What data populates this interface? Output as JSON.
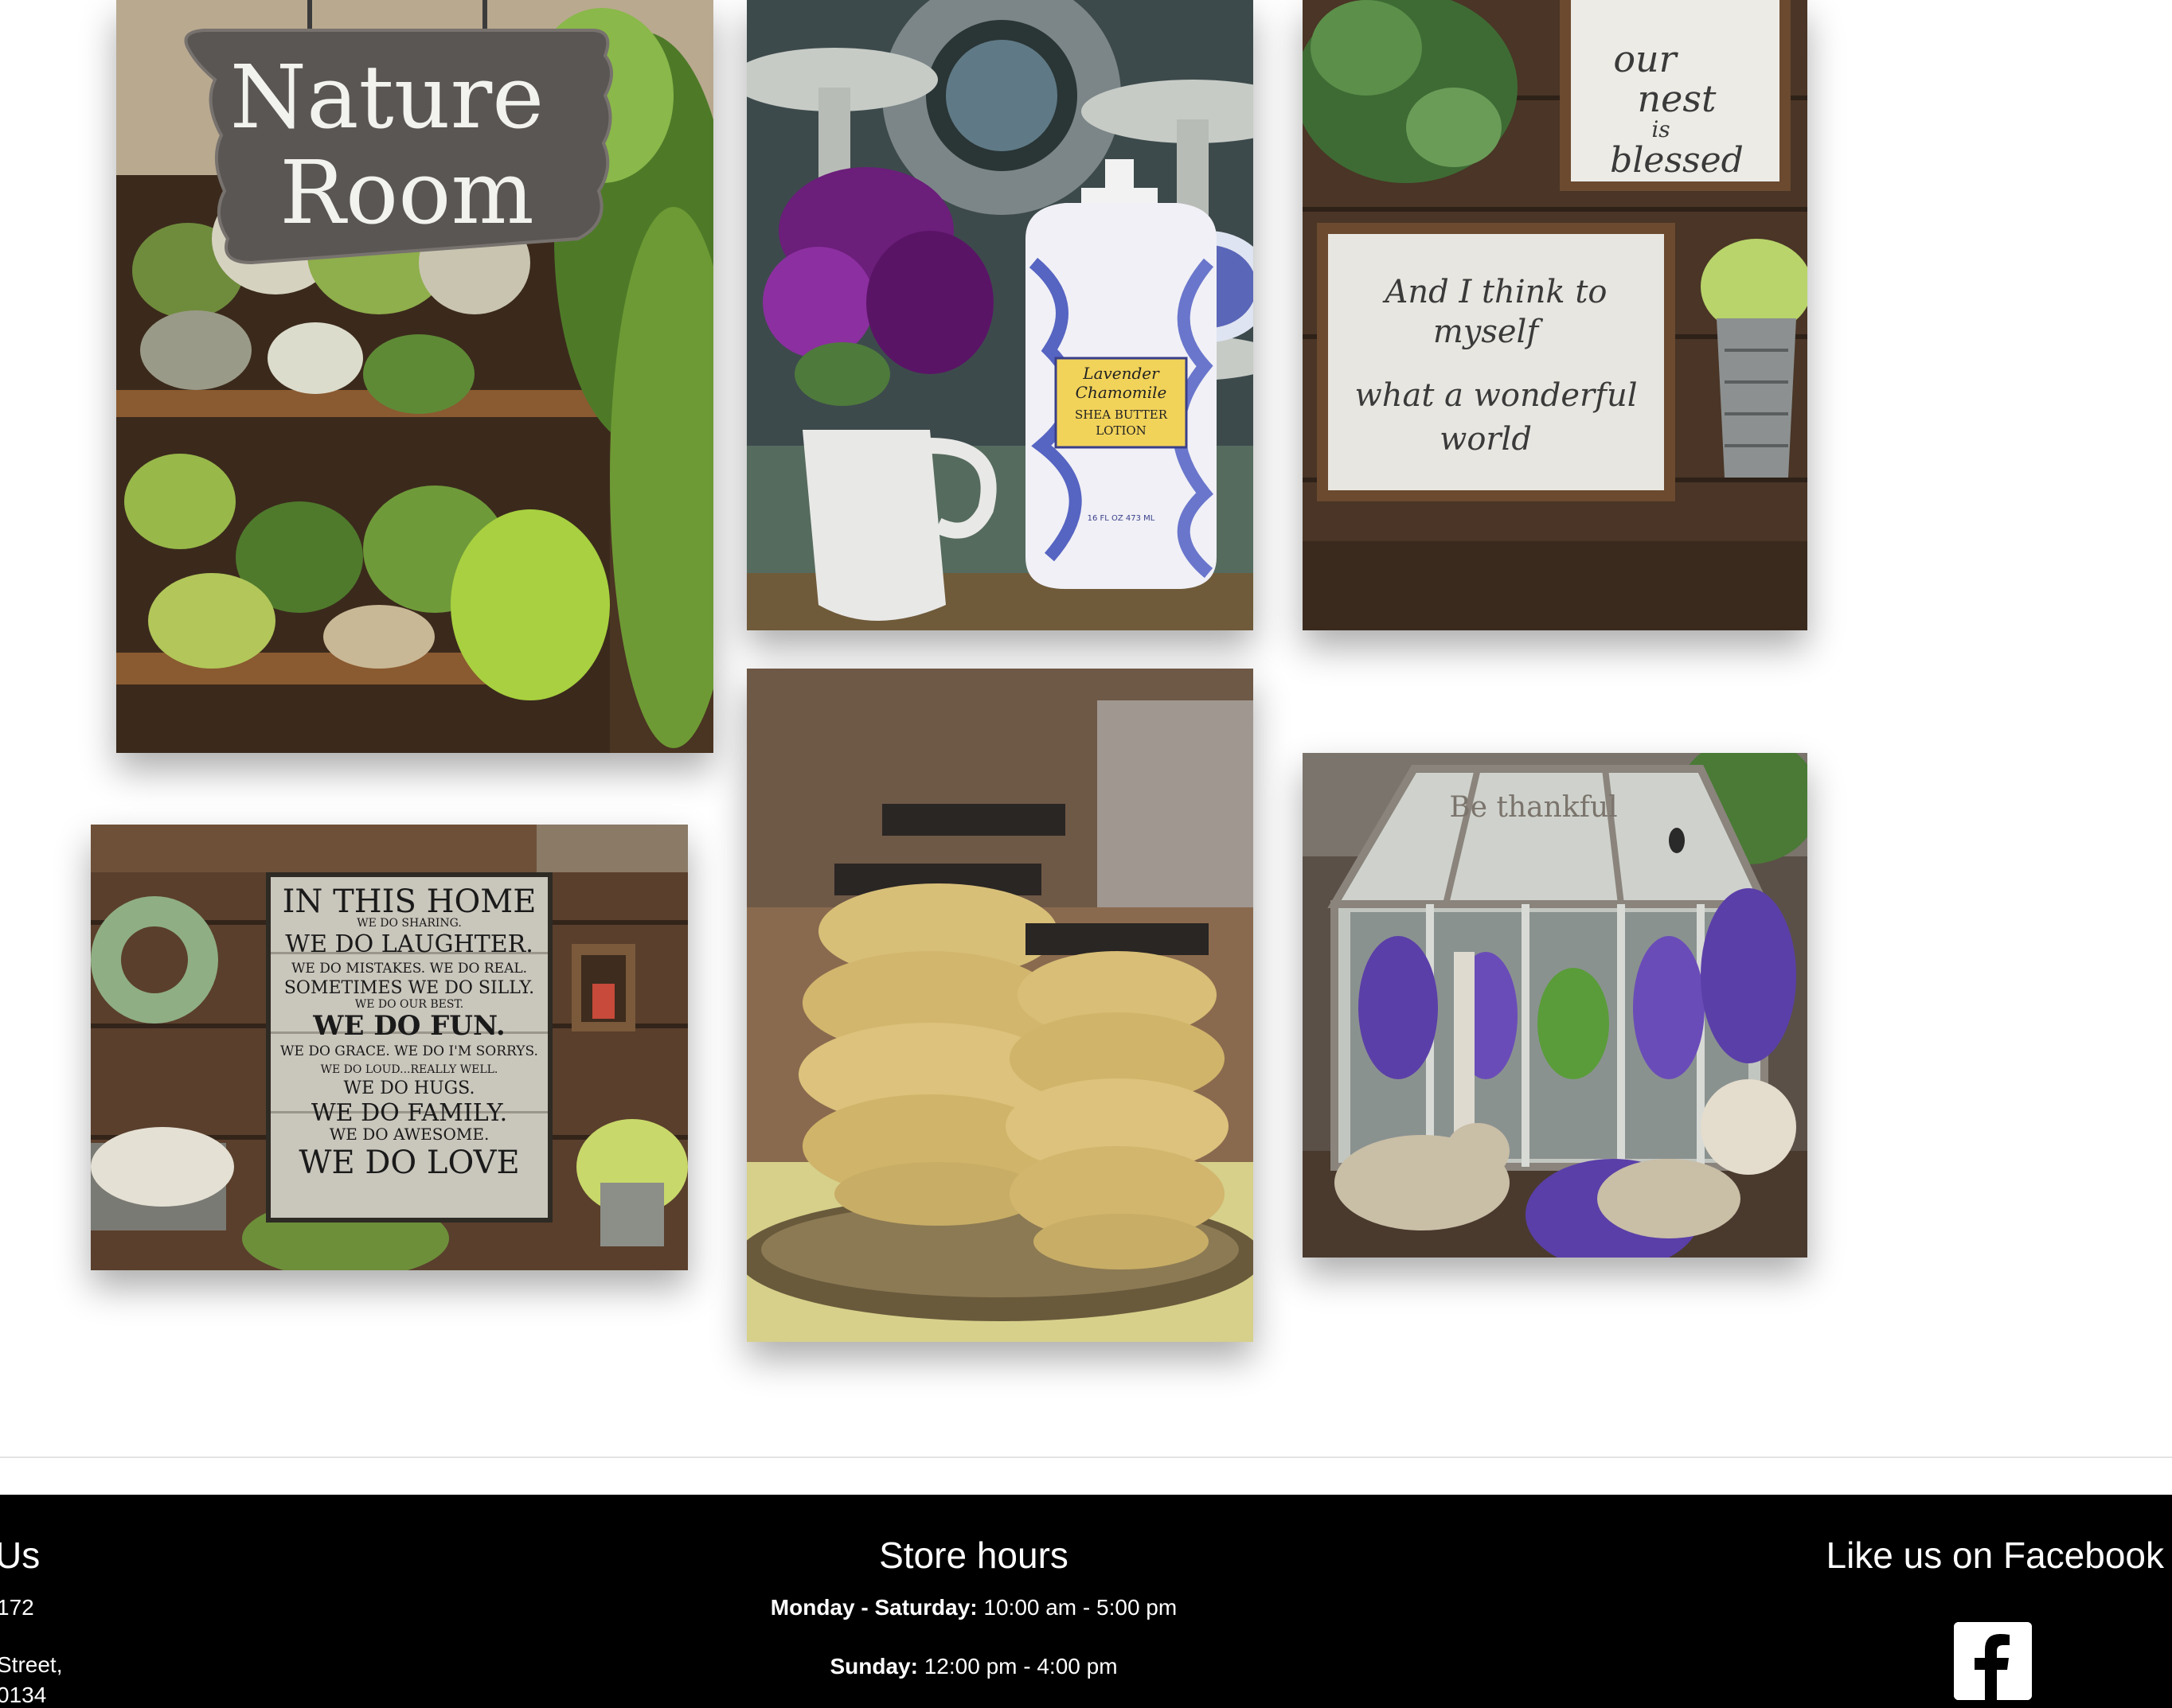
{
  "gallery": {
    "photos": [
      {
        "name": "Nature Room sign with plant shelves",
        "sign_lines": [
          "Nature",
          "Room"
        ]
      },
      {
        "name": "Lavender chamomile lotion bottle",
        "label_lines": [
          "Lavender",
          "Chamomile",
          "SHEA BUTTER",
          "LOTION"
        ],
        "small_label": "16 FL OZ 473 ML"
      },
      {
        "name": "Our nest is blessed signs",
        "sign_small": [
          "our",
          "nest",
          "is",
          "blessed"
        ],
        "sign_large": [
          "And I think to",
          "myself",
          "what a wonderful",
          "world"
        ]
      },
      {
        "name": "In this home sign",
        "lines": [
          "IN THIS HOME",
          "WE DO SHARING.",
          "WE DO LAUGHTER.",
          "WE DO MISTAKES. WE DO REAL.",
          "SOMETIMES WE DO SILLY.",
          "WE DO OUR BEST.",
          "WE DO FUN.",
          "WE DO GRACE. WE DO I'M SORRYS.",
          "WE DO LOUD...REALLY WELL.",
          "WE DO HUGS.",
          "WE DO FAMILY.",
          "WE DO AWESOME.",
          "WE DO LOVE"
        ]
      },
      {
        "name": "Beehive honey jars"
      },
      {
        "name": "Glass terrarium with lavender",
        "glass_text": "Be thankful"
      }
    ]
  },
  "footer": {
    "contact": {
      "heading": "Us",
      "phone": "172",
      "street": "Street,",
      "zip": "0134"
    },
    "hours": {
      "heading": "Store hours",
      "weekday_label": "Monday - Saturday:",
      "weekday_value": " 10:00 am - 5:00 pm",
      "sunday_label": "Sunday:",
      "sunday_value": " 12:00 pm - 4:00 pm"
    },
    "facebook": {
      "heading": "Like us on Facebook",
      "icon": "facebook-icon"
    }
  },
  "colors": {
    "footer_bg": "#000000",
    "footer_text": "#ffffff",
    "page_bg": "#ffffff"
  }
}
